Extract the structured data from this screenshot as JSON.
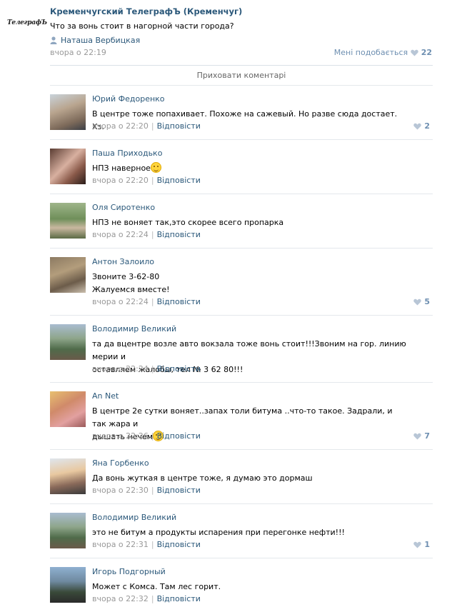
{
  "post": {
    "logo_text": "ТелеграфЪ",
    "title": "Кременчугский ТелеграфЪ (Кременчуг)",
    "text": "Что за вонь стоит в нагорной части города?",
    "author": "Наташа Вербицкая",
    "time": "вчора о 22:19",
    "like_label": "Мені подобається",
    "like_count": "22"
  },
  "hide_comments_label": "Приховати коментарі",
  "reply_label": "Відповісти",
  "colors": {
    "link": "#2b587a",
    "meta": "#999999",
    "like": "#6e8fb1"
  },
  "comments": [
    {
      "author": "Юрий Федоренко",
      "lines": [
        "В центре тоже попахивает. Похоже на сажевый. Но разве сюда достает. Хз."
      ],
      "time": "вчора о 22:20",
      "likes": "2",
      "emoji": ""
    },
    {
      "author": "Паша Приходько",
      "lines": [
        "НПЗ наверное"
      ],
      "time": "вчора о 22:20",
      "likes": "",
      "emoji": "wink-emoji"
    },
    {
      "author": "Оля Сиротенко",
      "lines": [
        "НПЗ не воняет так,это скорее всего пропарка"
      ],
      "time": "вчора о 22:24",
      "likes": "",
      "emoji": ""
    },
    {
      "author": "Антон Залоило",
      "lines": [
        "Звоните 3-62-80",
        "Жалуемся вместе!"
      ],
      "time": "вчора о 22:24",
      "likes": "5",
      "emoji": ""
    },
    {
      "author": "Володимир Великий",
      "lines": [
        "та да вцентре возле авто вокзала тоже вонь стоит!!!Звоним на гор. линию мерии и",
        "оставляем жалобы, тел № 3 62 80!!!"
      ],
      "time": "вчора о 22:24",
      "likes": "",
      "emoji": ""
    },
    {
      "author": "An Net",
      "lines": [
        "В центре 2е сутки воняет..запах толи битума ..что-то такое. Задрали, и так жара и",
        "дышать нечем"
      ],
      "time": "вчора о 22:26",
      "likes": "7",
      "emoji": "tired-emoji"
    },
    {
      "author": "Яна Горбенко",
      "lines": [
        "Да вонь жуткая в центре тоже, я думаю это дормаш"
      ],
      "time": "вчора о 22:30",
      "likes": "",
      "emoji": ""
    },
    {
      "author": "Володимир Великий",
      "lines": [
        "это не битум а продукты испарения при перегонке нефти!!!"
      ],
      "time": "вчора о 22:31",
      "likes": "1",
      "emoji": ""
    },
    {
      "author": "Игорь Подгорный",
      "lines": [
        "Может с Комса. Там лес горит."
      ],
      "time": "вчора о 22:32",
      "likes": "",
      "emoji": ""
    }
  ]
}
